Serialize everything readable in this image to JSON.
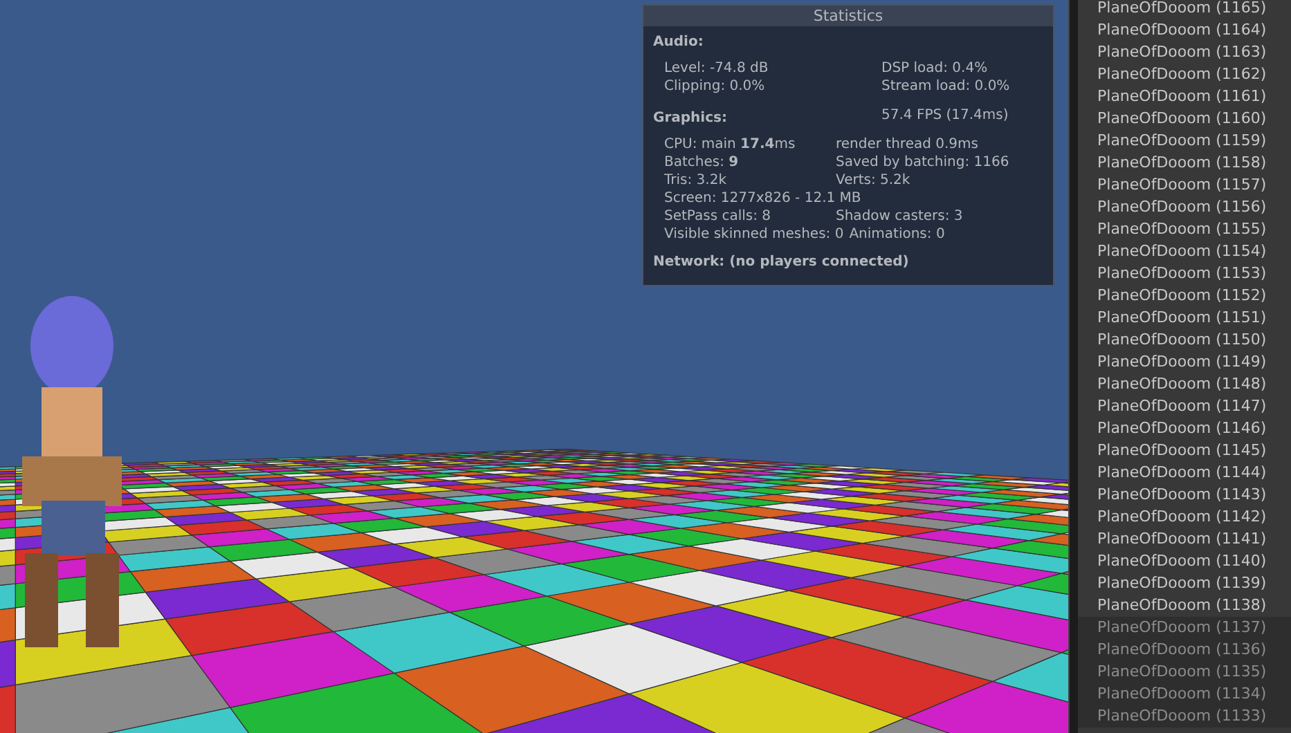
{
  "statistics": {
    "title": "Statistics",
    "audio": {
      "heading": "Audio:",
      "rows": [
        {
          "left": "Level: -74.8 dB",
          "right": "DSP load: 0.4%"
        },
        {
          "left": "Clipping: 0.0%",
          "right": "Stream load: 0.0%"
        }
      ]
    },
    "graphics": {
      "heading": "Graphics:",
      "fps": "57.4 FPS (17.4ms)",
      "rows": [
        {
          "left": "CPU: main **17.4**ms",
          "right": "render thread 0.9ms"
        },
        {
          "left": "Batches: **9**",
          "right": "Saved by batching: 1166"
        },
        {
          "left": "Tris: 3.2k",
          "right": "Verts: 5.2k"
        },
        {
          "left": "Screen: 1277x826 - 12.1 MB",
          "right": ""
        },
        {
          "left": "SetPass calls: 8",
          "right": "Shadow casters: 3"
        },
        {
          "left": "Visible skinned meshes: 0",
          "right": "Animations: 0"
        }
      ]
    },
    "network": "Network: (no players connected)"
  },
  "hierarchy": {
    "items": [
      {
        "label": "PlaneOfDooom (1165)",
        "disabled": false
      },
      {
        "label": "PlaneOfDooom (1164)",
        "disabled": false
      },
      {
        "label": "PlaneOfDooom (1163)",
        "disabled": false
      },
      {
        "label": "PlaneOfDooom (1162)",
        "disabled": false
      },
      {
        "label": "PlaneOfDooom (1161)",
        "disabled": false
      },
      {
        "label": "PlaneOfDooom (1160)",
        "disabled": false
      },
      {
        "label": "PlaneOfDooom (1159)",
        "disabled": false
      },
      {
        "label": "PlaneOfDooom (1158)",
        "disabled": false
      },
      {
        "label": "PlaneOfDooom (1157)",
        "disabled": false
      },
      {
        "label": "PlaneOfDooom (1156)",
        "disabled": false
      },
      {
        "label": "PlaneOfDooom (1155)",
        "disabled": false
      },
      {
        "label": "PlaneOfDooom (1154)",
        "disabled": false
      },
      {
        "label": "PlaneOfDooom (1153)",
        "disabled": false
      },
      {
        "label": "PlaneOfDooom (1152)",
        "disabled": false
      },
      {
        "label": "PlaneOfDooom (1151)",
        "disabled": false
      },
      {
        "label": "PlaneOfDooom (1150)",
        "disabled": false
      },
      {
        "label": "PlaneOfDooom (1149)",
        "disabled": false
      },
      {
        "label": "PlaneOfDooom (1148)",
        "disabled": false
      },
      {
        "label": "PlaneOfDooom (1147)",
        "disabled": false
      },
      {
        "label": "PlaneOfDooom (1146)",
        "disabled": false
      },
      {
        "label": "PlaneOfDooom (1145)",
        "disabled": false
      },
      {
        "label": "PlaneOfDooom (1144)",
        "disabled": false
      },
      {
        "label": "PlaneOfDooom (1143)",
        "disabled": false
      },
      {
        "label": "PlaneOfDooom (1142)",
        "disabled": false
      },
      {
        "label": "PlaneOfDooom (1141)",
        "disabled": false
      },
      {
        "label": "PlaneOfDooom (1140)",
        "disabled": false
      },
      {
        "label": "PlaneOfDooom (1139)",
        "disabled": false
      },
      {
        "label": "PlaneOfDooom (1138)",
        "disabled": false
      },
      {
        "label": "PlaneOfDooom (1137)",
        "disabled": true
      },
      {
        "label": "PlaneOfDooom (1136)",
        "disabled": true
      },
      {
        "label": "PlaneOfDooom (1135)",
        "disabled": true
      },
      {
        "label": "PlaneOfDooom (1134)",
        "disabled": true
      },
      {
        "label": "PlaneOfDooom (1133)",
        "disabled": true
      }
    ]
  }
}
